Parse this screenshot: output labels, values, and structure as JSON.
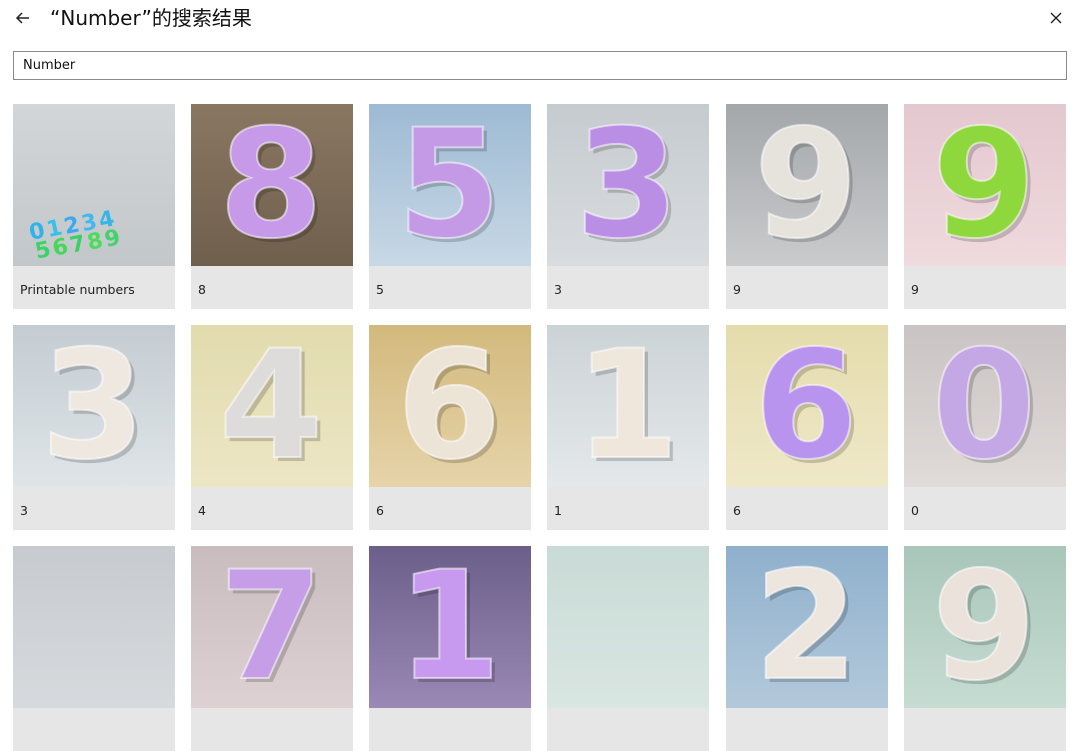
{
  "header": {
    "title": "“Number”的搜索结果"
  },
  "search": {
    "value": "Number"
  },
  "results": [
    {
      "label": "Printable numbers",
      "glyph": "",
      "icon": "multicolor-digits-image",
      "bg_top": "#d3d6d8",
      "bg_bottom": "#c2c7ca",
      "color": "#3bb8e8"
    },
    {
      "label": "8",
      "glyph": "8",
      "icon": "purple-8-image",
      "bg_top": "#8a7762",
      "bg_bottom": "#6f5f4d",
      "color": "#c69ae9"
    },
    {
      "label": "5",
      "glyph": "5",
      "icon": "purple-5-image",
      "bg_top": "#9dbad3",
      "bg_bottom": "#c8d8e6",
      "color": "#c49ae7"
    },
    {
      "label": "3",
      "glyph": "3",
      "icon": "purple-3-image",
      "bg_top": "#c6cbcf",
      "bg_bottom": "#d8dcdf",
      "color": "#b98ee4"
    },
    {
      "label": "9",
      "glyph": "9",
      "icon": "white-9-image",
      "bg_top": "#a4a7aa",
      "bg_bottom": "#c9cbcd",
      "color": "#e6e2dc"
    },
    {
      "label": "9",
      "glyph": "9",
      "icon": "green-9-image",
      "bg_top": "#e4c8cf",
      "bg_bottom": "#efdade",
      "color": "#8ed83e"
    },
    {
      "label": "3",
      "glyph": "3",
      "icon": "white-3-image",
      "bg_top": "#c4ccd2",
      "bg_bottom": "#dfe5e8",
      "color": "#efe8e0"
    },
    {
      "label": "4",
      "glyph": "4",
      "icon": "white-4-image",
      "bg_top": "#e2dbae",
      "bg_bottom": "#ece6c5",
      "color": "#dedcda"
    },
    {
      "label": "6",
      "glyph": "6",
      "icon": "white-6-image",
      "bg_top": "#d2b97d",
      "bg_bottom": "#e6d4a9",
      "color": "#ede4d8"
    },
    {
      "label": "1",
      "glyph": "1",
      "icon": "white-1-image",
      "bg_top": "#ccd3d6",
      "bg_bottom": "#e4e8ea",
      "color": "#efe6dc"
    },
    {
      "label": "6",
      "glyph": "6",
      "icon": "purple-6-image",
      "bg_top": "#e5dcac",
      "bg_bottom": "#efe8c8",
      "color": "#b894ee"
    },
    {
      "label": "0",
      "glyph": "0",
      "icon": "purple-0-image",
      "bg_top": "#c9c3c3",
      "bg_bottom": "#e0dbd9",
      "color": "#c4a8e6"
    },
    {
      "label": "",
      "glyph": "",
      "icon": "partial-image",
      "bg_top": "#c7cbcf",
      "bg_bottom": "#d7dadd",
      "color": "#cccccc"
    },
    {
      "label": "",
      "glyph": "7",
      "icon": "purple-7-image",
      "bg_top": "#c9bcbf",
      "bg_bottom": "#ddd1d3",
      "color": "#c59ee7"
    },
    {
      "label": "",
      "glyph": "1",
      "icon": "purple-1-image",
      "bg_top": "#6b5f8a",
      "bg_bottom": "#9a88b5",
      "color": "#c79af0"
    },
    {
      "label": "",
      "glyph": "",
      "icon": "partial-image",
      "bg_top": "#c9dbd6",
      "bg_bottom": "#d9e6e2",
      "color": "#cccccc"
    },
    {
      "label": "",
      "glyph": "2",
      "icon": "white-2-image",
      "bg_top": "#8fb0cc",
      "bg_bottom": "#b3c9db",
      "color": "#ece6de"
    },
    {
      "label": "",
      "glyph": "9",
      "icon": "white-9-image",
      "bg_top": "#a9c6bb",
      "bg_bottom": "#c6dcd3",
      "color": "#ece2dc"
    }
  ]
}
